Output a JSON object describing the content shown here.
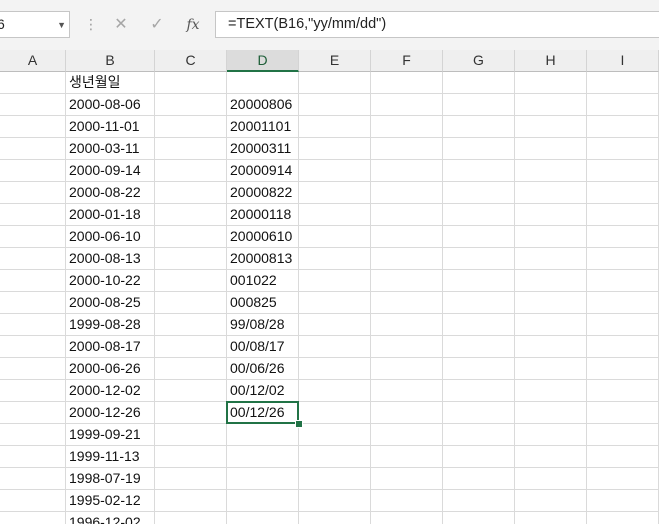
{
  "name_box": {
    "value": "6"
  },
  "formula_bar": {
    "cancel_icon": "close-icon",
    "enter_icon": "check-icon",
    "function_label": "fx",
    "formula": "=TEXT(B16,\"yy/mm/dd\")"
  },
  "columns": [
    "A",
    "B",
    "C",
    "D",
    "E",
    "F",
    "G",
    "H",
    "I"
  ],
  "active_column": "D",
  "rows": [
    {
      "b": "생년월일",
      "d": ""
    },
    {
      "b": "2000-08-06",
      "d": "20000806"
    },
    {
      "b": "2000-11-01",
      "d": "20001101"
    },
    {
      "b": "2000-03-11",
      "d": "20000311"
    },
    {
      "b": "2000-09-14",
      "d": "20000914"
    },
    {
      "b": "2000-08-22",
      "d": "20000822"
    },
    {
      "b": "2000-01-18",
      "d": "20000118"
    },
    {
      "b": "2000-06-10",
      "d": "20000610"
    },
    {
      "b": "2000-08-13",
      "d": "20000813"
    },
    {
      "b": "2000-10-22",
      "d": "001022"
    },
    {
      "b": "2000-08-25",
      "d": "000825"
    },
    {
      "b": "1999-08-28",
      "d": "99/08/28"
    },
    {
      "b": "2000-08-17",
      "d": "00/08/17"
    },
    {
      "b": "2000-06-26",
      "d": "00/06/26"
    },
    {
      "b": "2000-12-02",
      "d": "00/12/02"
    },
    {
      "b": "2000-12-26",
      "d": "00/12/26"
    },
    {
      "b": "1999-09-21",
      "d": ""
    },
    {
      "b": "1999-11-13",
      "d": ""
    },
    {
      "b": "1998-07-19",
      "d": ""
    },
    {
      "b": "1995-02-12",
      "d": ""
    },
    {
      "b": "1996-12-02",
      "d": ""
    }
  ],
  "selected_row_index": 15,
  "accent_color": "#217346"
}
